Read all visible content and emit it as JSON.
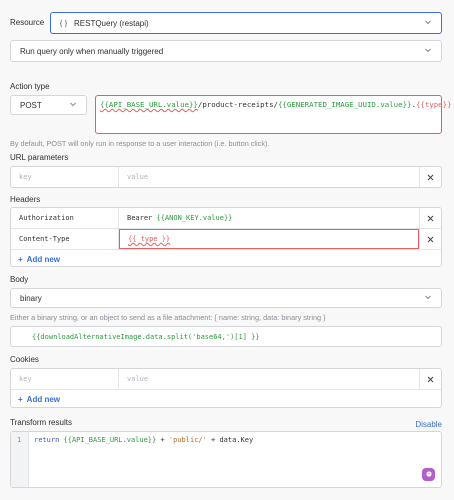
{
  "resource": {
    "label": "Resource",
    "value": "RESTQuery (restapi)",
    "icon": "braces-icon"
  },
  "trigger": {
    "value": "Run query only when manually triggered"
  },
  "action_type": {
    "label": "Action type",
    "method": "POST",
    "url_parts": [
      "{{API_BASE_URL.value}}",
      "/product-receipts/",
      "{{GENERATED_IMAGE_UUID.value}}",
      ".",
      "{{type}}"
    ],
    "hint": "By default, POST will only run in response to a user interaction (i.e. button click)."
  },
  "url_params": {
    "label": "URL parameters",
    "key_placeholder": "key",
    "value_placeholder": "value"
  },
  "headers": {
    "label": "Headers",
    "rows": [
      {
        "key": "Authorization",
        "value_prefix": "Bearer ",
        "value_var": "{{ANON_KEY.value}}"
      },
      {
        "key": "Content-Type",
        "value_var": "{{ type }}"
      }
    ],
    "add_new": "Add new"
  },
  "body": {
    "label": "Body",
    "type": "binary",
    "hint": "Either a binary string, or an object to send as a file attachment: { name: string, data: binary string }",
    "code": "{{downloadAlternativeImage.data.split('base64,')[1] }}"
  },
  "cookies": {
    "label": "Cookies",
    "key_placeholder": "key",
    "value_placeholder": "value",
    "add_new": "Add new"
  },
  "transform": {
    "label": "Transform results",
    "disable": "Disable",
    "line_number": "1",
    "code_kw": "return",
    "code_var": "{{API_BASE_URL.value}}",
    "code_op1": " + ",
    "code_str": "'public/'",
    "code_op2": " + data.Key"
  },
  "colors": {
    "accent": "#3b6fd4",
    "variable": "#2c9b3e",
    "error": "#e0605e",
    "ai_badge": "#b45fc9"
  }
}
